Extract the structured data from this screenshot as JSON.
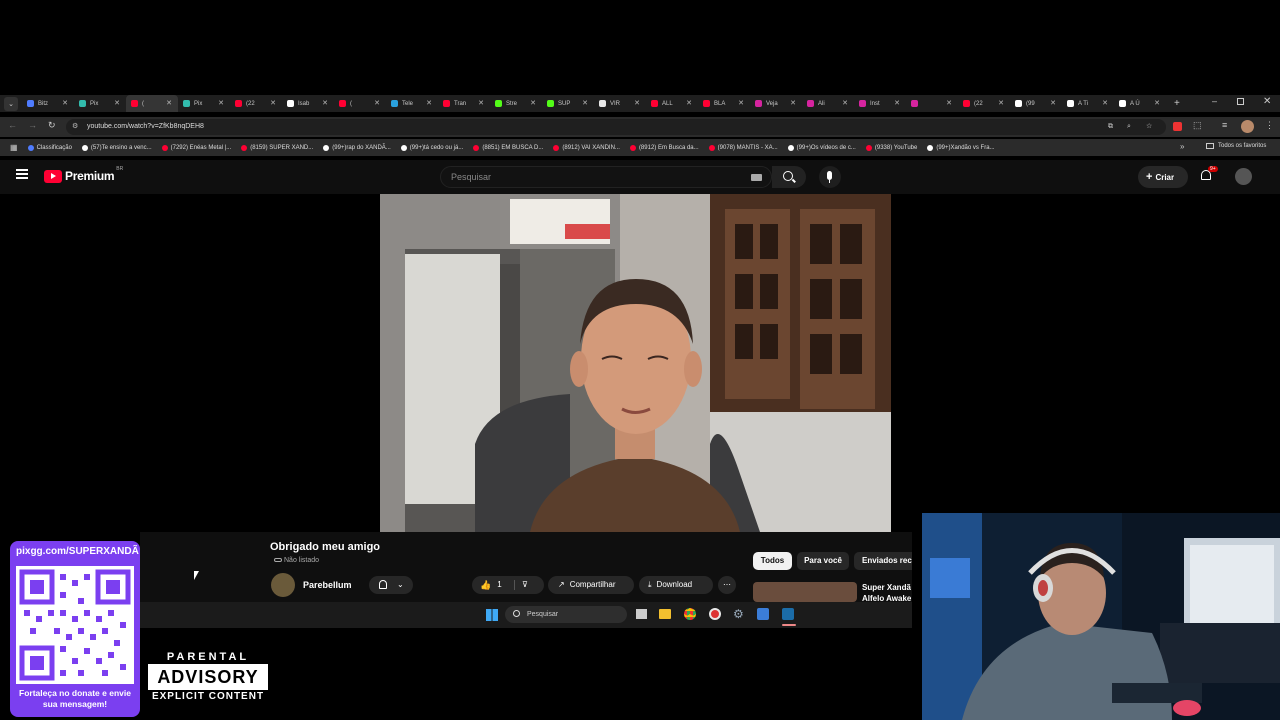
{
  "browser": {
    "tabs": [
      {
        "label": "Bitz",
        "color": "#4f7cff"
      },
      {
        "label": "Pix",
        "color": "#32bcad"
      },
      {
        "label": "(",
        "color": "#ff0033",
        "active": true
      },
      {
        "label": "Pix",
        "color": "#32bcad"
      },
      {
        "label": "(22",
        "color": "#ff0033"
      },
      {
        "label": "Isab",
        "color": "#ffffff"
      },
      {
        "label": "(",
        "color": "#ff0033"
      },
      {
        "label": "Tele",
        "color": "#2aa1de"
      },
      {
        "label": "Tran",
        "color": "#ff0033"
      },
      {
        "label": "Stre",
        "color": "#53fc18"
      },
      {
        "label": "SUP",
        "color": "#53fc18"
      },
      {
        "label": "VIR",
        "color": "#e8e8e8"
      },
      {
        "label": "ALL",
        "color": "#ff0033"
      },
      {
        "label": "BLA",
        "color": "#ff0033"
      },
      {
        "label": "Veja",
        "color": "#d6249f"
      },
      {
        "label": "Ali",
        "color": "#d6249f"
      },
      {
        "label": "Inst",
        "color": "#d6249f"
      },
      {
        "label": "",
        "color": "#d6249f"
      },
      {
        "label": "(22",
        "color": "#ff0033"
      },
      {
        "label": "(99",
        "color": "#ffffff"
      },
      {
        "label": "A Ti",
        "color": "#ffffff"
      },
      {
        "label": "A Ú",
        "color": "#ffffff"
      }
    ],
    "url": "youtube.com/watch?v=ZfKb8nqDEH8",
    "bookmarks": [
      {
        "label": "Classificação",
        "color": "#4f7cff"
      },
      {
        "label": "(57)Te ensino a venc...",
        "color": "#ffffff"
      },
      {
        "label": "(7292) Enéas Metal |...",
        "color": "#ff0033"
      },
      {
        "label": "(8159) SUPER XAND...",
        "color": "#ff0033"
      },
      {
        "label": "(99+)rap do XANDÃ...",
        "color": "#ffffff"
      },
      {
        "label": "(99+)tá cedo ou já...",
        "color": "#ffffff"
      },
      {
        "label": "(8851) EM BUSCA D...",
        "color": "#ff0033"
      },
      {
        "label": "(8912) VAI XANDIN...",
        "color": "#ff0033"
      },
      {
        "label": "(8912) Em Busca da...",
        "color": "#ff0033"
      },
      {
        "label": "(9078) MANTIS - XA...",
        "color": "#ff0033"
      },
      {
        "label": "(99+)Os vídeos de c...",
        "color": "#ffffff"
      },
      {
        "label": "(9338) YouTube",
        "color": "#ff0033"
      },
      {
        "label": "(99+)Xandão vs Fra...",
        "color": "#ffffff"
      }
    ],
    "all_favorites": "Todos os favoritos"
  },
  "youtube": {
    "logo_text": "Premium",
    "region": "BR",
    "search_placeholder": "Pesquisar",
    "create_label": "Criar",
    "notif_badge": "9+",
    "video_title": "Obrigado meu amigo",
    "visibility": "Não listado",
    "channel": "Parebellum",
    "likes": "1",
    "share_label": "Compartilhar",
    "download_label": "Download",
    "chips": [
      "Todos",
      "Para você",
      "Enviados rec"
    ],
    "related_title": "Super Xandã",
    "related_subtitle": "Alfelo Awake"
  },
  "taskbar": {
    "search_placeholder": "Pesquisar"
  },
  "overlay": {
    "qr_url": "pixgg.com/SUPERXANDÃ",
    "qr_message": "Fortaleça no donate e envie sua mensagem!",
    "advisory_line1": "PARENTAL",
    "advisory_line2": "ADVISORY",
    "advisory_line3": "EXPLICIT CONTENT"
  },
  "colors": {
    "accent_red": "#ff0033",
    "qr_panel": "#7b3ff0"
  }
}
